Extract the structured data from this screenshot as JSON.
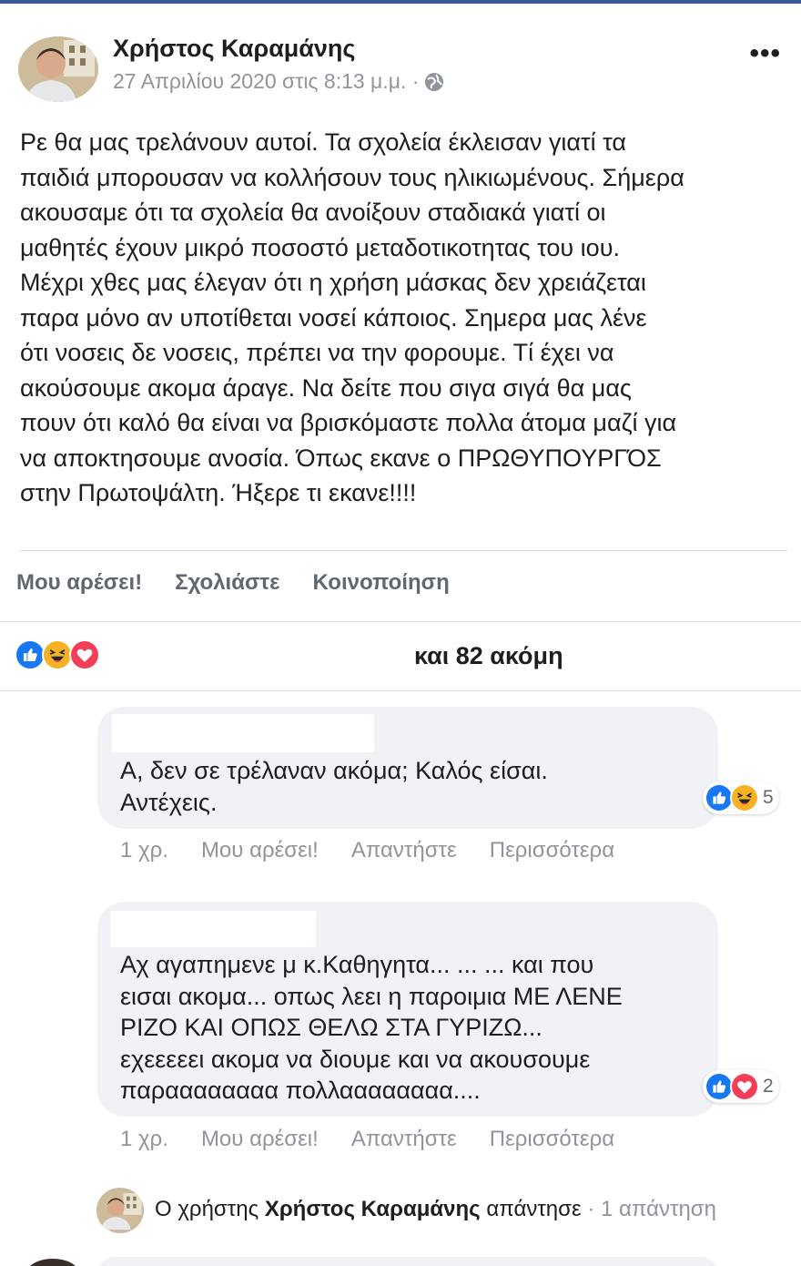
{
  "post": {
    "author": "Χρήστος Καραμάνης",
    "timestamp": "27 Απριλίου 2020 στις 8:13 μ.μ. ·",
    "privacy_icon": "globe-icon",
    "more_label": "•••",
    "text": "Ρε θα μας τρελάνουν αυτοί. Τα σχολεία έκλεισαν γιατί τα\nπαιδιά μπορουσαν να κολλήσουν τους ηλικιωμένους. Σήμερα\nακουσαμε ότι τα σχολεία θα ανοίξουν σταδιακά γιατί οι\nμαθητές έχουν μικρό ποσοστό μεταδοτικοτητας του ιου.\nΜέχρι χθες μας έλεγαν ότι η χρήση μάσκας δεν χρειάζεται\nπαρα μόνο αν υποτίθεται νοσεί κάποιος. Σημερα μας λένε\nότι νοσεις δε νοσεις, πρέπει να την φορουμε. Τί έχει να\nακούσουμε ακομα άραγε. Να δείτε που σιγα σιγά θα μας\nπουν ότι καλό θα είναι να βρισκόμαστε πολλα άτομα μαζί για\nνα αποκτησουμε ανοσία. Όπως εκανε ο ΠΡΩΘΥΠΟΥΡΓΌΣ\nστην Πρωτοψάλτη. Ήξερε τι εκανε!!!!"
  },
  "actions": {
    "like": "Μου αρέσει!",
    "comment": "Σχολιάστε",
    "share": "Κοινοποίηση"
  },
  "reactions": {
    "icons": [
      "like-icon",
      "haha-icon",
      "love-icon"
    ],
    "summary": "και 82 ακόμη"
  },
  "comments": [
    {
      "text": "Α, δεν σε τρέλαναν ακόμα; Καλός είσαι.\nΑντέχεις.",
      "reaction_icons": [
        "like-icon",
        "haha-icon"
      ],
      "reaction_count": "5",
      "time": "1 χρ.",
      "like": "Μου αρέσει!",
      "reply": "Απαντήστε",
      "more": "Περισσότερα"
    },
    {
      "text": "Αχ αγαπημενε μ κ.Καθηγητα... ... ... και που\nεισαι ακομα... οπως λεει η παροιμια ΜΕ ΛΕΝΕ\nΡΙΖΟ ΚΑΙ ΟΠΩΣ ΘΕΛΩ ΣΤΑ ΓΥΡΙΖΩ...\nεχεεεεει ακομα να διουμε και να ακουσουμε\nπαραααααααα πολλαααααααα....",
      "reaction_icons": [
        "like-icon",
        "love-icon"
      ],
      "reaction_count": "2",
      "time": "1 χρ.",
      "like": "Μου αρέσει!",
      "reply": "Απαντήστε",
      "more": "Περισσότερα"
    }
  ],
  "reply_summary": {
    "prefix": "Ο χρήστης",
    "author": "Χρήστος Καραμάνης",
    "verb": "απάντησε",
    "count": "· 1 απάντηση"
  },
  "colors": {
    "brand": "#3b5998",
    "like_blue": "#1877f2",
    "love_red": "#f33e58",
    "haha_yellow": "#f7b125",
    "muted_text": "#90949c",
    "bubble_bg": "#f0f2f5"
  }
}
